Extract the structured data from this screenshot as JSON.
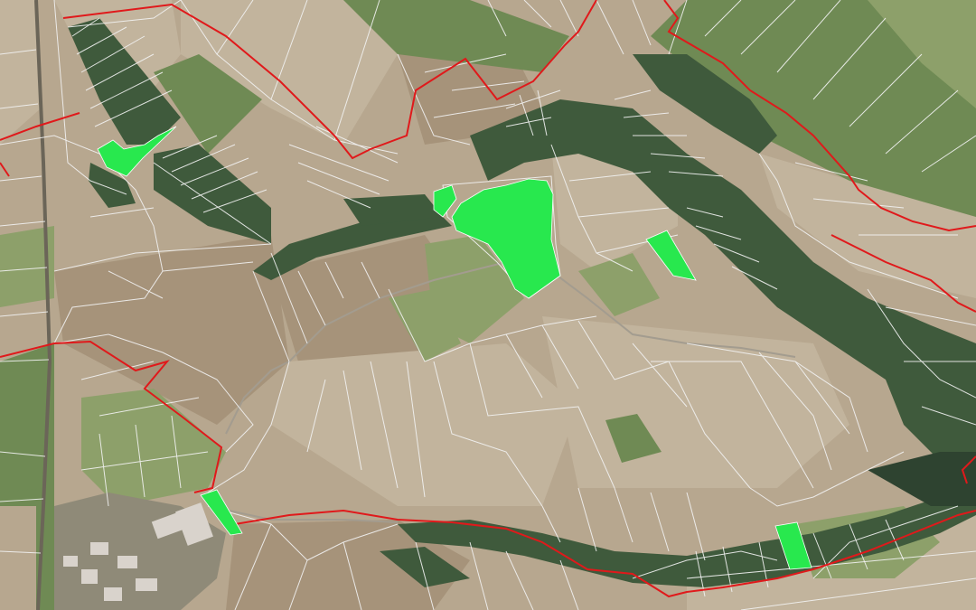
{
  "map": {
    "type": "cadastral-parcel-overlay-on-aerial-imagery",
    "colors": {
      "fields_base": "#b7a78f",
      "field_light": "#c2b49d",
      "field_dark": "#a6937a",
      "crop_green": "#6f8a54",
      "crop_green_light": "#8da06a",
      "forest": "#3f5a3c",
      "forest_dark": "#2e4330",
      "parcel_border": "#f2f2f2",
      "boundary_red": "#e0191b",
      "highlight_green": "#28e84e",
      "road": "#d8d0c4",
      "village_roof": "#d9d3cc"
    },
    "layers": [
      {
        "id": "aerial",
        "visible": true
      },
      {
        "id": "parcel-boundaries",
        "visible": true
      },
      {
        "id": "admin-boundary-red",
        "visible": true
      },
      {
        "id": "selected-parcels",
        "visible": true,
        "count": 6
      }
    ]
  }
}
